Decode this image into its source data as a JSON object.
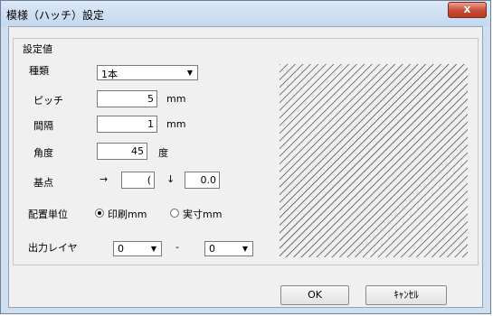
{
  "window": {
    "title": "模様（ハッチ）設定",
    "close_label": "x"
  },
  "group": {
    "label": "設定値"
  },
  "kind": {
    "label": "種類",
    "value": "1本"
  },
  "pitch": {
    "label": "ピッチ",
    "value": "5",
    "unit": "mm"
  },
  "spacing": {
    "label": "間隔",
    "value": "1",
    "unit": "mm"
  },
  "angle": {
    "label": "角度",
    "value": "45",
    "unit": "度"
  },
  "base_point": {
    "label": "基点",
    "right_arrow": "→",
    "x_value": "(",
    "down_arrow": "↓",
    "y_value": "0.0"
  },
  "placement_unit": {
    "label": "配置単位",
    "option_print": "印刷mm",
    "option_actual": "実寸mm",
    "selected": "印刷mm"
  },
  "output_layer": {
    "label": "出力レイヤ",
    "from_value": "0",
    "separator": "-",
    "to_value": "0"
  },
  "buttons": {
    "ok": "OK",
    "cancel": "ｷｬﾝｾﾙ"
  },
  "preview": {
    "pattern": "diagonal-hatch",
    "angle_deg": 45
  }
}
